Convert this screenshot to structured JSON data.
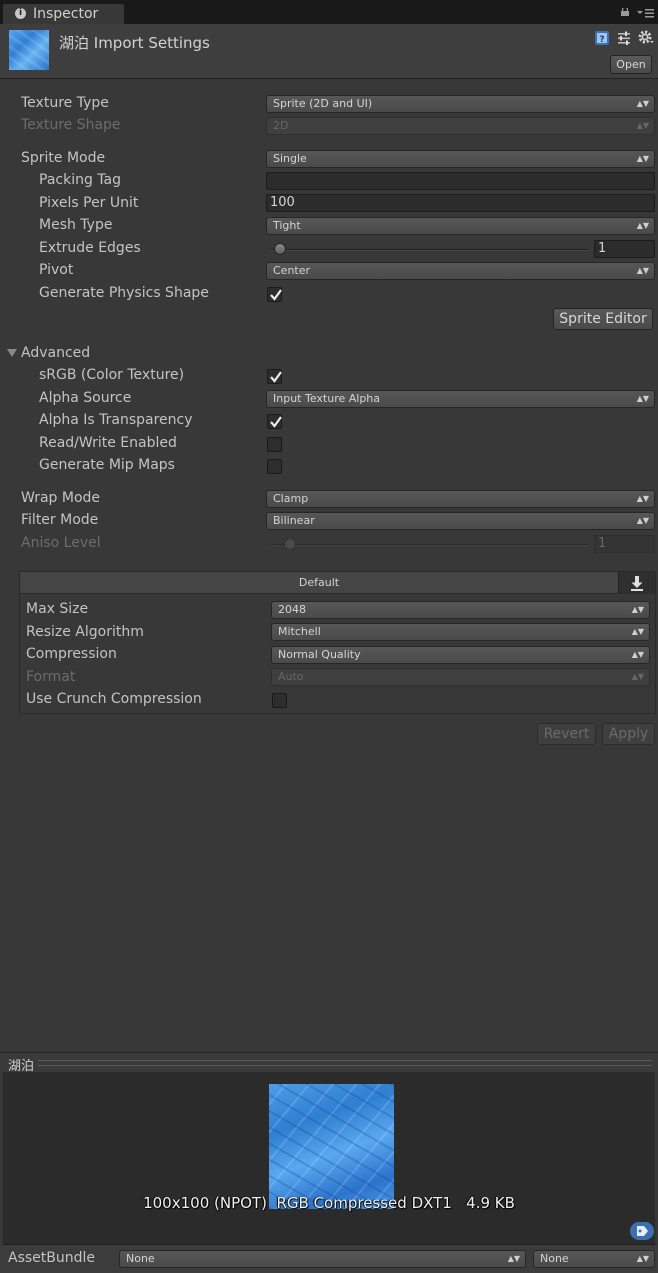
{
  "tab": {
    "label": "Inspector",
    "info_glyph": "i"
  },
  "header": {
    "title": "湖泊 Import Settings",
    "open_label": "Open"
  },
  "texture_type": {
    "label": "Texture Type",
    "value": "Sprite (2D and UI)"
  },
  "texture_shape": {
    "label": "Texture Shape",
    "value": "2D"
  },
  "sprite_mode": {
    "label": "Sprite Mode",
    "value": "Single"
  },
  "packing_tag": {
    "label": "Packing Tag",
    "value": ""
  },
  "pixels_per_unit": {
    "label": "Pixels Per Unit",
    "value": "100"
  },
  "mesh_type": {
    "label": "Mesh Type",
    "value": "Tight"
  },
  "extrude_edges": {
    "label": "Extrude Edges",
    "value": "1",
    "slider_fraction": 0.03
  },
  "pivot": {
    "label": "Pivot",
    "value": "Center"
  },
  "generate_physics_shape": {
    "label": "Generate Physics Shape",
    "checked": true
  },
  "sprite_editor_label": "Sprite Editor",
  "advanced": {
    "label": "Advanced",
    "srgb": {
      "label": "sRGB (Color Texture)",
      "checked": true
    },
    "alpha_source": {
      "label": "Alpha Source",
      "value": "Input Texture Alpha"
    },
    "alpha_is_transparency": {
      "label": "Alpha Is Transparency",
      "checked": true
    },
    "read_write": {
      "label": "Read/Write Enabled",
      "checked": false
    },
    "mip_maps": {
      "label": "Generate Mip Maps",
      "checked": false
    }
  },
  "wrap_mode": {
    "label": "Wrap Mode",
    "value": "Clamp"
  },
  "filter_mode": {
    "label": "Filter Mode",
    "value": "Bilinear"
  },
  "aniso_level": {
    "label": "Aniso Level",
    "value": "1",
    "slider_fraction": 0.06
  },
  "platform": {
    "tab_label": "Default",
    "max_size": {
      "label": "Max Size",
      "value": "2048"
    },
    "resize_algorithm": {
      "label": "Resize Algorithm",
      "value": "Mitchell"
    },
    "compression": {
      "label": "Compression",
      "value": "Normal Quality"
    },
    "format": {
      "label": "Format",
      "value": "Auto"
    },
    "crunch": {
      "label": "Use Crunch Compression",
      "checked": false
    }
  },
  "revert_label": "Revert",
  "apply_label": "Apply",
  "preview": {
    "title": "湖泊",
    "info": "100x100 (NPOT)  RGB Compressed DXT1   4.9 KB"
  },
  "asset_bundle": {
    "label": "AssetBundle",
    "name_value": "None",
    "variant_value": "None"
  },
  "colors": {
    "background": "#383838",
    "tab_bar": "#191919",
    "texture_blue": "#3b8ae0"
  },
  "icons": [
    "info-icon",
    "lock-icon",
    "tab-menu-icon",
    "help-book-icon",
    "sliders-icon",
    "gear-icon",
    "checkmark-icon",
    "dropdown-arrow-icon",
    "download-icon",
    "tag-icon"
  ]
}
